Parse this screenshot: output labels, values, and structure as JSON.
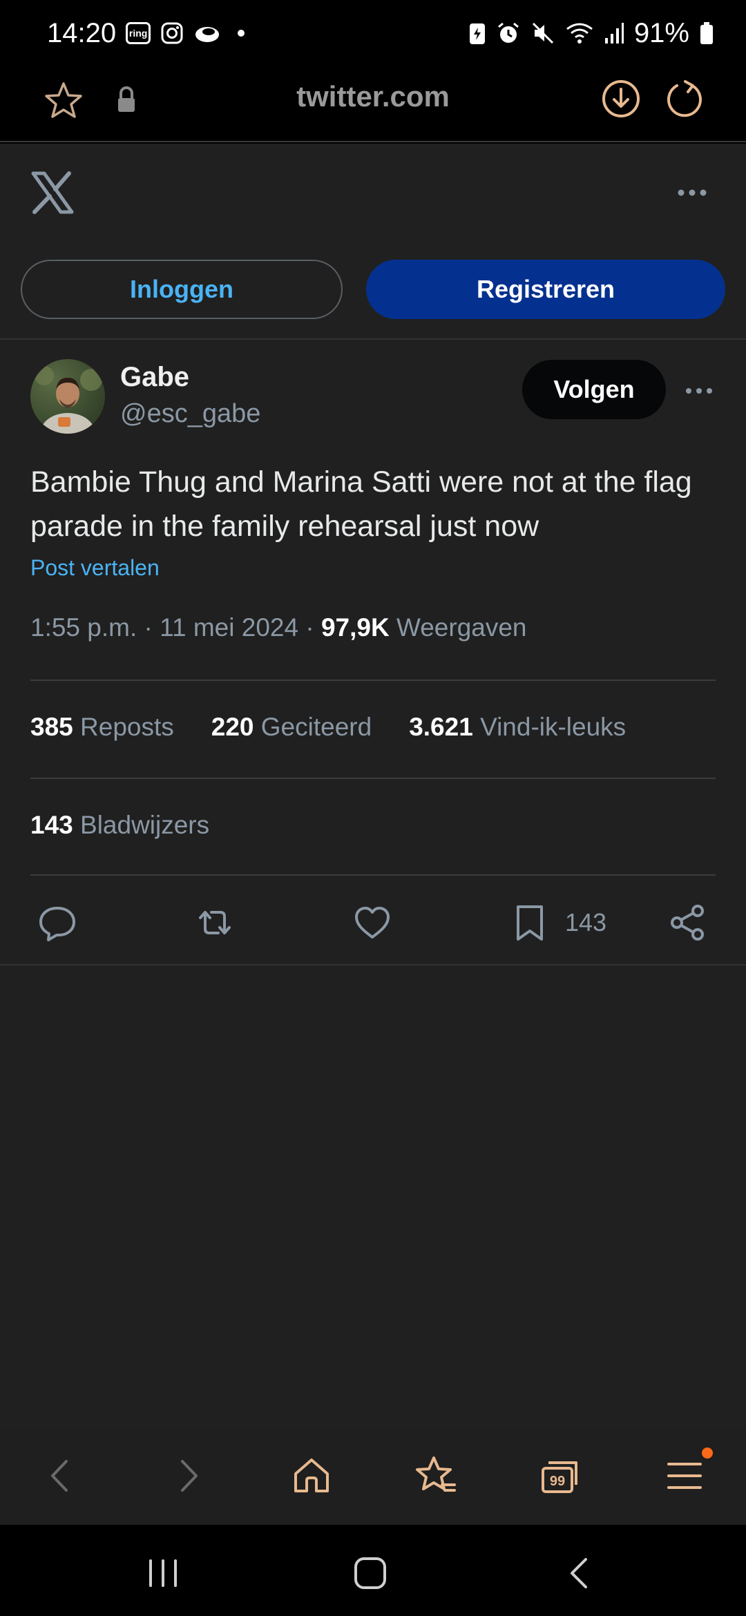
{
  "status_bar": {
    "time": "14:20",
    "ring_badge": "ring",
    "battery": "91%",
    "icons": [
      "ring-icon",
      "instagram-icon",
      "cloud-icon",
      "dot-icon",
      "battery-saver-icon",
      "alarm-icon",
      "mute-icon",
      "wifi-icon",
      "signal-icon",
      "battery-icon"
    ]
  },
  "browser": {
    "url": "twitter.com",
    "icons": [
      "star-icon",
      "lock-icon",
      "download-icon",
      "reload-icon"
    ]
  },
  "header": {
    "icons": [
      "x-logo-icon",
      "more-icon"
    ]
  },
  "auth": {
    "login_label": "Inloggen",
    "register_label": "Registreren"
  },
  "author": {
    "name": "Gabe",
    "handle": "@esc_gabe",
    "follow_label": "Volgen"
  },
  "tweet": {
    "text": "Bambie Thug and Marina Satti were not at the flag parade in the family rehearsal just now",
    "translate_label": "Post vertalen",
    "time": "1:55 p.m.",
    "date": "11 mei 2024",
    "views_count": "97,9K",
    "views_label": "Weergaven",
    "separator": "·"
  },
  "stats": {
    "reposts_count": "385",
    "reposts_label": "Reposts",
    "quotes_count": "220",
    "quotes_label": "Geciteerd",
    "likes_count": "3.621",
    "likes_label": "Vind-ik-leuks",
    "bookmarks_count": "143",
    "bookmarks_label": "Bladwijzers"
  },
  "actions": {
    "bookmark_count": "143",
    "icons": [
      "reply-icon",
      "repost-icon",
      "like-icon",
      "bookmark-icon",
      "share-icon"
    ]
  },
  "browser_bottom": {
    "tabs_count": "99",
    "icons": [
      "back-icon",
      "forward-icon",
      "home-icon",
      "bookmarks-icon",
      "tabs-icon",
      "menu-icon"
    ]
  },
  "system_nav": {
    "icons": [
      "recents-icon",
      "home-button-icon",
      "back-button-icon"
    ]
  },
  "colors": {
    "accent_link": "#4ab3f4",
    "register_button": "#04318f",
    "page_background": "#202020",
    "notification_dot": "#ff6a1a"
  }
}
